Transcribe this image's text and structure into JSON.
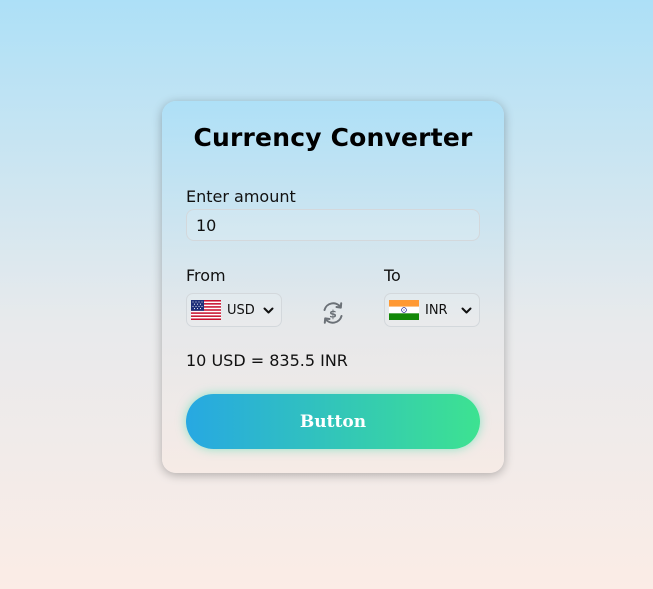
{
  "converter": {
    "title": "Currency Converter",
    "amount_label": "Enter amount",
    "amount_value": "10",
    "from_label": "From",
    "to_label": "To",
    "from_currency": "USD",
    "from_flag_icon": "us-flag-icon",
    "to_currency": "INR",
    "to_flag_icon": "india-flag-icon",
    "swap_icon": "currency-swap-icon",
    "result_text": "10 USD = 835.5 INR",
    "button_label": "Button"
  },
  "colors": {
    "button_gradient_start": "#27a8e2",
    "button_gradient_end": "#3de291",
    "background_top": "#ade0f7",
    "background_bottom": "#fbece6"
  }
}
